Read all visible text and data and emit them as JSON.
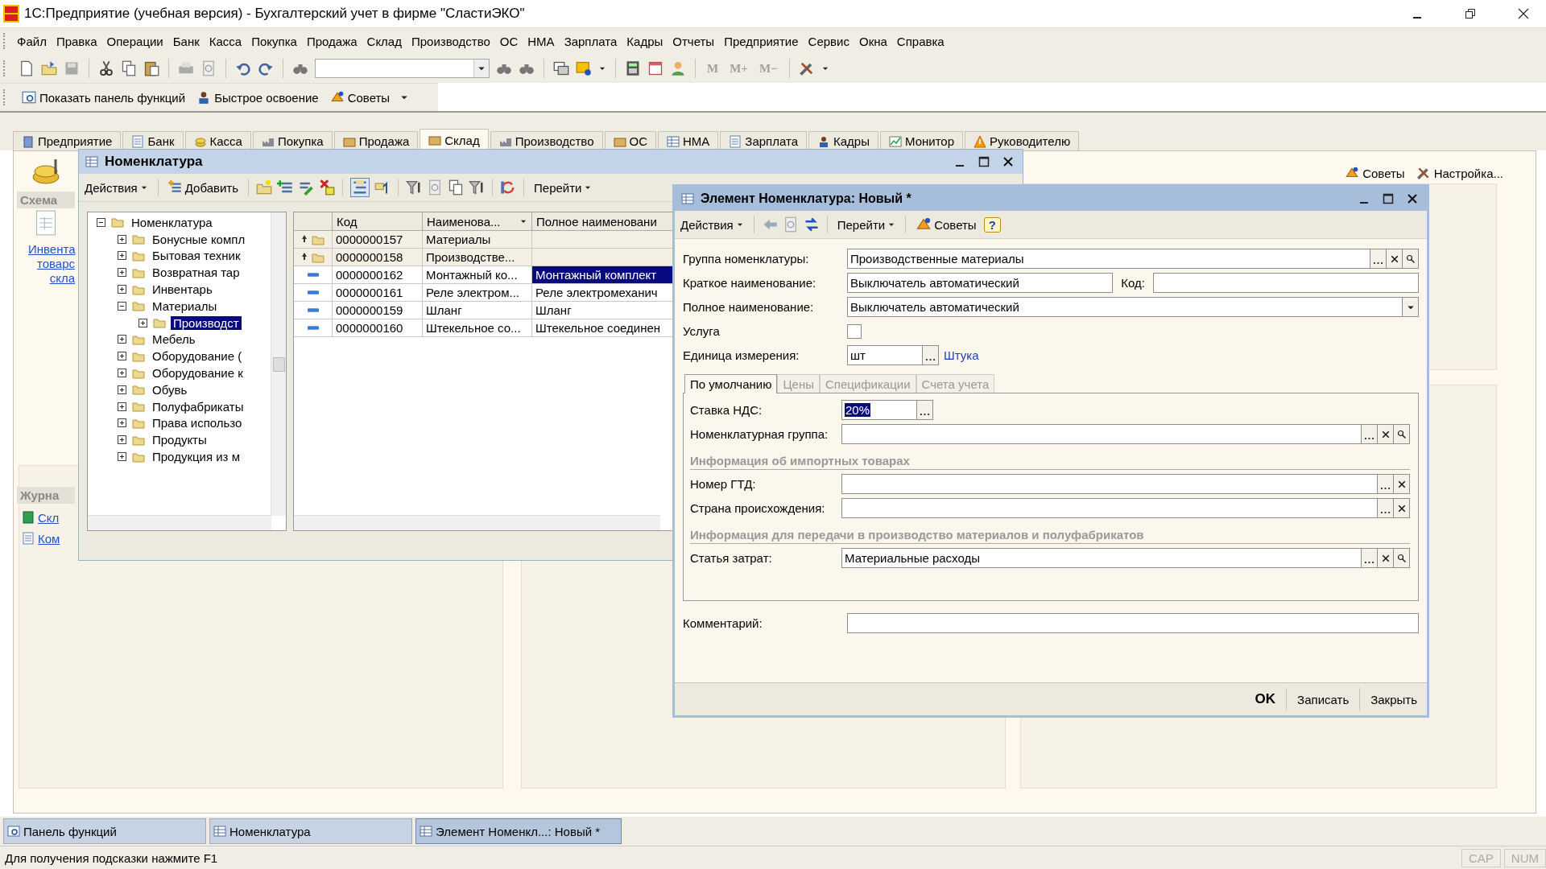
{
  "window": {
    "title": "1С:Предприятие (учебная версия) - Бухгалтерский учет в фирме \"СластиЭКО\""
  },
  "menu": [
    "Файл",
    "Правка",
    "Операции",
    "Банк",
    "Касса",
    "Покупка",
    "Продажа",
    "Склад",
    "Производство",
    "ОС",
    "НМА",
    "Зарплата",
    "Кадры",
    "Отчеты",
    "Предприятие",
    "Сервис",
    "Окна",
    "Справка"
  ],
  "memory_buttons": [
    {
      "label": "M",
      "disabled": true
    },
    {
      "label": "M+",
      "disabled": true
    },
    {
      "label": "M−",
      "disabled": true
    }
  ],
  "panel_toolbar": [
    "Показать панель функций",
    "Быстрое освоение",
    "Советы"
  ],
  "sections": [
    {
      "label": "Предприятие",
      "selected": false
    },
    {
      "label": "Банк",
      "selected": false
    },
    {
      "label": "Касса",
      "selected": false
    },
    {
      "label": "Покупка",
      "selected": false
    },
    {
      "label": "Продажа",
      "selected": false
    },
    {
      "label": "Склад",
      "selected": true
    },
    {
      "label": "Производство",
      "selected": false
    },
    {
      "label": "ОС",
      "selected": false
    },
    {
      "label": "НМА",
      "selected": false
    },
    {
      "label": "Зарплата",
      "selected": false
    },
    {
      "label": "Кадры",
      "selected": false
    },
    {
      "label": "Монитор",
      "selected": false
    },
    {
      "label": "Руководителю",
      "selected": false
    }
  ],
  "workspace": {
    "schema_heading": "Схема",
    "schema_link": "Инвента товарс скла",
    "journals_heading": "Журна",
    "journal_links": [
      "Скл",
      "Ком"
    ],
    "tips": "Советы",
    "settings": "Настройка..."
  },
  "catalog_window": {
    "title": "Номенклатура",
    "actions": "Действия",
    "add": "Добавить",
    "goto": "Перейти",
    "tree": [
      {
        "label": "Номенклатура",
        "expanded": true,
        "selected": false,
        "children": [
          {
            "label": "Бонусные компл",
            "expanded": false,
            "selected": false
          },
          {
            "label": "Бытовая техник",
            "expanded": false,
            "selected": false
          },
          {
            "label": "Возвратная тар",
            "expanded": false,
            "selected": false
          },
          {
            "label": "Инвентарь",
            "expanded": false,
            "selected": false
          },
          {
            "label": "Материалы",
            "expanded": true,
            "selected": false,
            "children": [
              {
                "label": "Производст",
                "expanded": false,
                "selected": true
              }
            ]
          },
          {
            "label": "Мебель",
            "expanded": false,
            "selected": false
          },
          {
            "label": "Оборудование (",
            "expanded": false,
            "selected": false
          },
          {
            "label": "Оборудование к",
            "expanded": false,
            "selected": false
          },
          {
            "label": "Обувь",
            "expanded": false,
            "selected": false
          },
          {
            "label": "Полуфабрикаты",
            "expanded": false,
            "selected": false
          },
          {
            "label": "Права использо",
            "expanded": false,
            "selected": false
          },
          {
            "label": "Продукты",
            "expanded": false,
            "selected": false
          },
          {
            "label": "Продукция из м",
            "expanded": false,
            "selected": false
          }
        ]
      }
    ],
    "columns": [
      "Код",
      "Наименова...",
      "Полное наименовани"
    ],
    "rows": [
      {
        "kind": "group",
        "code": "0000000157",
        "name": "Материалы",
        "selected": false
      },
      {
        "kind": "group",
        "code": "0000000158",
        "name": "Производстве...",
        "selected": false
      },
      {
        "kind": "item",
        "code": "0000000162",
        "name": "Монтажный ко...",
        "full_name": "Монтажный комплект",
        "selected": true
      },
      {
        "kind": "item",
        "code": "0000000161",
        "name": "Реле электром...",
        "full_name": "Реле электромеханич",
        "selected": false
      },
      {
        "kind": "item",
        "code": "0000000159",
        "name": "Шланг",
        "full_name": "Шланг",
        "selected": false
      },
      {
        "kind": "item",
        "code": "0000000160",
        "name": "Штекельное со...",
        "full_name": "Штекельное соединен",
        "selected": false
      }
    ]
  },
  "item_dialog": {
    "title": "Элемент Номенклатура: Новый *",
    "actions": "Действия",
    "goto": "Перейти",
    "tips": "Советы",
    "help": "?",
    "fields": [
      {
        "kind": "lookup",
        "label": "Группа номенклатуры:",
        "value": "Производственные материалы"
      },
      {
        "kind": "text_code",
        "label": "Краткое наименование:",
        "value": "Выключатель автоматический",
        "code_label": "Код:"
      },
      {
        "kind": "select",
        "label": "Полное наименование:",
        "value": "Выключатель автоматический"
      },
      {
        "kind": "checkbox",
        "label": "Услуга",
        "checked": false
      },
      {
        "kind": "unit",
        "label": "Единица измерения:",
        "value": "шт",
        "link": "Штука"
      }
    ],
    "tabs": [
      {
        "label": "По умолчанию",
        "selected": true
      },
      {
        "label": "Цены",
        "selected": false
      },
      {
        "label": "Спецификации",
        "selected": false
      },
      {
        "label": "Счета учета",
        "selected": false
      }
    ],
    "tab_content": [
      {
        "kind": "vat",
        "label": "Ставка НДС:",
        "value": "20%"
      },
      {
        "kind": "lookup",
        "label": "Номенклатурная группа:"
      },
      {
        "kind": "heading",
        "label": "Информация об импортных товарах"
      },
      {
        "kind": "choice",
        "label": "Номер ГТД:"
      },
      {
        "kind": "choice",
        "label": "Страна происхождения:"
      },
      {
        "kind": "heading",
        "label": "Информация для передачи в производство материалов и полуфабрикатов"
      },
      {
        "kind": "lookup",
        "label": "Статья затрат:",
        "value": "Материальные расходы"
      }
    ],
    "comment_label": "Комментарий:",
    "buttons": [
      "OK",
      "Записать",
      "Закрыть"
    ]
  },
  "taskbar": [
    {
      "label": "Панель функций",
      "selected": false
    },
    {
      "label": "Номенклатура",
      "selected": false
    },
    {
      "label": "Элемент Номенкл...: Новый *",
      "selected": true
    }
  ],
  "status_bar": {
    "hint": "Для получения подсказки нажмите F1",
    "indicators": [
      "CAP",
      "NUM"
    ]
  }
}
